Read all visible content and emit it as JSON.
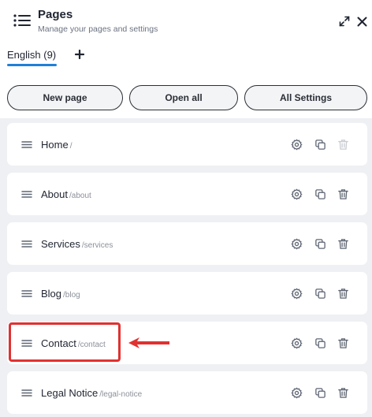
{
  "header": {
    "title": "Pages",
    "subtitle": "Manage your pages and settings"
  },
  "tabs": [
    {
      "label": "English (9)",
      "active": true
    }
  ],
  "buttons": {
    "new_page": "New page",
    "open_all": "Open all",
    "all_settings": "All Settings"
  },
  "pages": [
    {
      "name": "Home",
      "slug": "/",
      "delete_enabled": false
    },
    {
      "name": "About",
      "slug": "/about",
      "delete_enabled": true
    },
    {
      "name": "Services",
      "slug": "/services",
      "delete_enabled": true
    },
    {
      "name": "Blog",
      "slug": "/blog",
      "delete_enabled": true
    },
    {
      "name": "Contact",
      "slug": "/contact",
      "delete_enabled": true
    },
    {
      "name": "Legal Notice",
      "slug": "/legal-notice",
      "delete_enabled": true
    }
  ],
  "icons": {
    "menu": "menu-list-icon",
    "expand": "expand-icon",
    "close": "close-icon",
    "add": "plus-icon",
    "drag": "drag-handle-icon",
    "settings": "settings-gear-icon",
    "duplicate": "duplicate-icon",
    "delete": "trash-icon"
  },
  "colors": {
    "accent": "#1f7fd8",
    "annotation": "#e03131",
    "icon": "#5f6673",
    "icon_disabled": "#c9ccd2"
  }
}
